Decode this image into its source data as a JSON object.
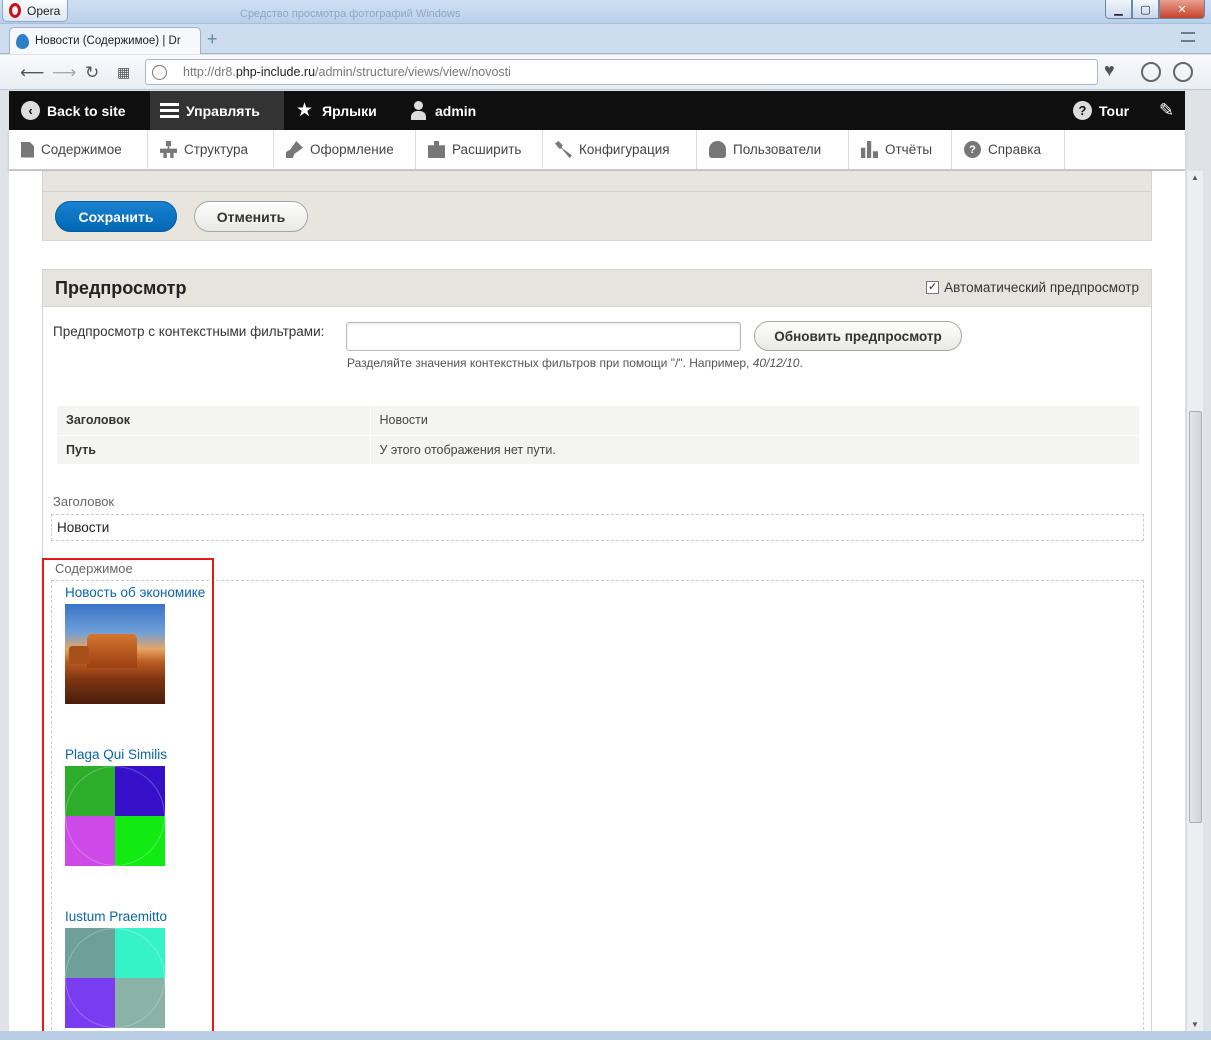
{
  "browser": {
    "app_button": "Opera",
    "bg_title": "Средство просмотра фотографий Windows",
    "tab_title": "Новости (Содержимое) | Dr",
    "url_prefix": "http://dr8.",
    "url_host": "php-include.ru",
    "url_path": "/admin/structure/views/view/novosti"
  },
  "toolbar": {
    "back": "Back to site",
    "manage": "Управлять",
    "shortcuts": "Ярлыки",
    "user": "admin",
    "tour": "Tour"
  },
  "tray": [
    {
      "label": "Содержимое",
      "icon": "document-icon"
    },
    {
      "label": "Структура",
      "icon": "structure-icon"
    },
    {
      "label": "Оформление",
      "icon": "brush-icon"
    },
    {
      "label": "Расширить",
      "icon": "puzzle-icon"
    },
    {
      "label": "Конфигурация",
      "icon": "wrench-icon"
    },
    {
      "label": "Пользователи",
      "icon": "people-icon"
    },
    {
      "label": "Отчёты",
      "icon": "bar-chart-icon"
    },
    {
      "label": "Справка",
      "icon": "help-icon"
    }
  ],
  "actions": {
    "save": "Сохранить",
    "cancel": "Отменить"
  },
  "preview": {
    "title": "Предпросмотр",
    "auto_label": "Автоматический предпросмотр",
    "auto_checked": true,
    "ctx_label": "Предпросмотр с контекстными фильтрами:",
    "ctx_value": "",
    "update_button": "Обновить предпросмотр",
    "help_text": "Разделяйте значения контекстных фильтров при помощи \"/\". Например,",
    "help_example": "40/12/10",
    "info_rows": [
      {
        "key": "Заголовок",
        "value": "Новости"
      },
      {
        "key": "Путь",
        "value": "У этого отображения нет пути."
      }
    ],
    "header_label": "Заголовок",
    "header_value": "Новости",
    "content_label": "Содержимое",
    "items": [
      {
        "title": "Новость об экономике",
        "image": "desert-photo"
      },
      {
        "title": "Plaga Qui Similis",
        "image": "color-grid",
        "colors": [
          "#2cae2a",
          "#3510c8",
          "#cd4ae8",
          "#12ea14"
        ]
      },
      {
        "title": "Iustum Praemitto",
        "image": "color-grid",
        "colors": [
          "#6e9f99",
          "#36f2c7",
          "#7a3cf0",
          "#8ab2a6"
        ]
      }
    ]
  },
  "colors": {
    "highlight": "#e01b1b",
    "primary": "#0067b3",
    "link": "#0a66a8"
  }
}
